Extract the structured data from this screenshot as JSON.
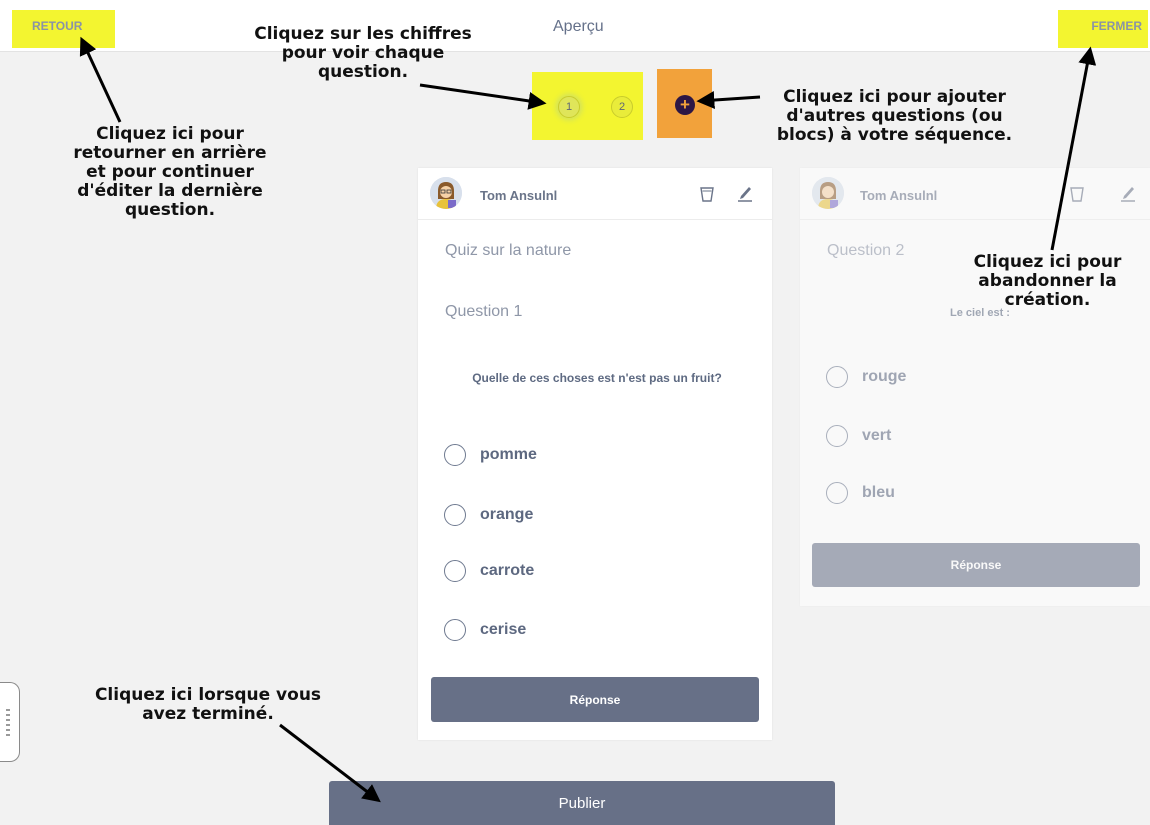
{
  "header": {
    "back_label": "RETOUR",
    "title": "Aperçu",
    "close_label": "FERMER"
  },
  "pager": {
    "pages": [
      "1",
      "2"
    ],
    "active": 1
  },
  "cards": [
    {
      "author": "Tom Ansulnl",
      "quiz_title": "Quiz sur la nature",
      "question_label": "Question 1",
      "question_text": "Quelle de ces choses est n'est pas un fruit?",
      "options": [
        "pomme",
        "orange",
        "carrote",
        "cerise"
      ],
      "answer_button": "Réponse"
    },
    {
      "author": "Tom Ansulnl",
      "question_label": "Question 2",
      "question_text": "Le ciel est :",
      "options": [
        "rouge",
        "vert",
        "bleu"
      ],
      "answer_button": "Réponse"
    }
  ],
  "publish_button": "Publier",
  "annotations": {
    "back": "Cliquez ici pour\nretourner en arrière\net pour continuer\nd'éditer la dernière\nquestion.",
    "numbers": "Cliquez sur les chiffres\npour voir chaque\nquestion.",
    "add": "Cliquez ici pour ajouter\nd'autres questions (ou\nblocs) à votre séquence.",
    "close": "Cliquez ici pour\nabandonner la\ncréation.",
    "publish": "Cliquez ici lorsque vous\navez terminé."
  },
  "colors": {
    "highlight": "#f3f530",
    "add_button": "#f2a23b",
    "button": "#677087"
  },
  "icons": [
    "plus-icon",
    "trash-icon",
    "pencil-icon",
    "avatar-icon",
    "radio-icon",
    "arrow-icon"
  ]
}
